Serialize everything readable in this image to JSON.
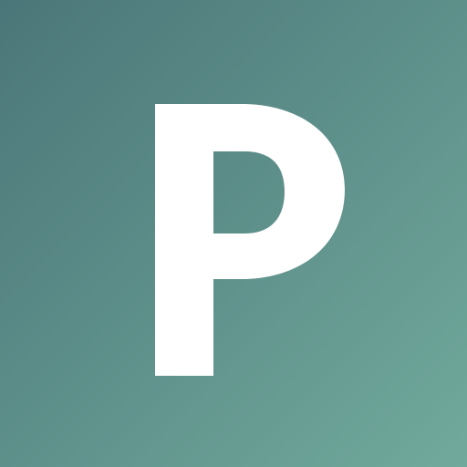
{
  "icon": {
    "letter": "P",
    "background_start": "#4b7679",
    "background_end": "#71aa9c",
    "letter_color": "#ffffff"
  }
}
